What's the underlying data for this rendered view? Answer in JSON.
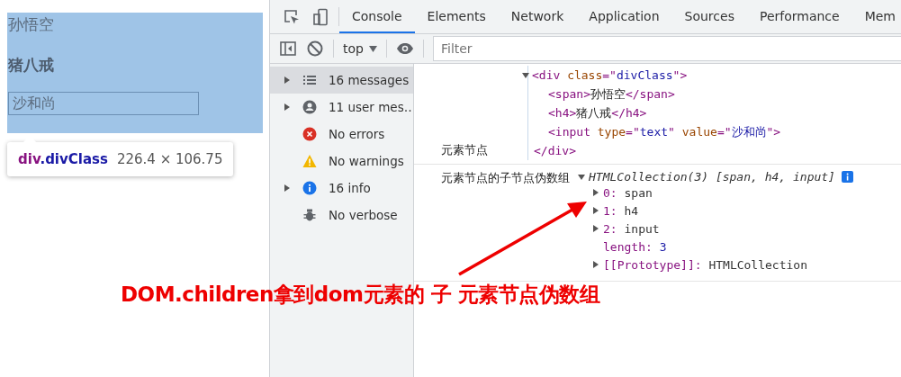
{
  "page": {
    "span_text": "孙悟空",
    "h4_text": "猪八戒",
    "input_value": "沙和尚",
    "tooltip": {
      "tag": "div",
      "cls": ".divClass",
      "size": "226.4 × 106.75"
    }
  },
  "tabs": [
    {
      "label": "Console",
      "selected": true
    },
    {
      "label": "Elements",
      "selected": false
    },
    {
      "label": "Network",
      "selected": false
    },
    {
      "label": "Application",
      "selected": false
    },
    {
      "label": "Sources",
      "selected": false
    },
    {
      "label": "Performance",
      "selected": false
    },
    {
      "label": "Mem",
      "selected": false
    }
  ],
  "context": "top",
  "filter": {
    "placeholder": "Filter"
  },
  "sidebar": [
    {
      "kind": "list",
      "label": "16 messages",
      "expandable": true,
      "selected": true
    },
    {
      "kind": "user",
      "label": "11 user mes…",
      "expandable": true,
      "selected": false
    },
    {
      "kind": "error",
      "label": "No errors",
      "expandable": false,
      "selected": false
    },
    {
      "kind": "warning",
      "label": "No warnings",
      "expandable": false,
      "selected": false
    },
    {
      "kind": "info",
      "label": "16 info",
      "expandable": true,
      "selected": false
    },
    {
      "kind": "verbose",
      "label": "No verbose",
      "expandable": false,
      "selected": false
    }
  ],
  "messages": [
    {
      "kind": "html",
      "label": "元素节点",
      "lines": [
        [
          {
            "kind": "tag",
            "s": "<div "
          },
          {
            "kind": "attr",
            "s": "class"
          },
          {
            "kind": "tag",
            "s": "=\""
          },
          {
            "kind": "val",
            "s": "divClass"
          },
          {
            "kind": "tag",
            "s": "\">"
          }
        ],
        [
          {
            "kind": "tag",
            "s": "<span>"
          },
          {
            "kind": "text",
            "s": "孙悟空"
          },
          {
            "kind": "tag",
            "s": "</span>"
          }
        ],
        [
          {
            "kind": "tag",
            "s": "<h4>"
          },
          {
            "kind": "text",
            "s": "猪八戒"
          },
          {
            "kind": "tag",
            "s": "</h4>"
          }
        ],
        [
          {
            "kind": "tag",
            "s": "<input "
          },
          {
            "kind": "attr",
            "s": "type"
          },
          {
            "kind": "tag",
            "s": "=\""
          },
          {
            "kind": "val",
            "s": "text"
          },
          {
            "kind": "tag",
            "s": "\" "
          },
          {
            "kind": "attr",
            "s": "value"
          },
          {
            "kind": "tag",
            "s": "=\""
          },
          {
            "kind": "val",
            "s": "沙和尚"
          },
          {
            "kind": "tag",
            "s": "\">"
          }
        ],
        [
          {
            "kind": "tag",
            "s": "</div>"
          }
        ]
      ]
    },
    {
      "kind": "object",
      "label": "元素节点的子节点伪数组",
      "summary": "HTMLCollection(3) [span, h4, input]",
      "rows": [
        {
          "key": "0:",
          "value": "span",
          "expandable": true
        },
        {
          "key": "1:",
          "value": "h4",
          "expandable": true
        },
        {
          "key": "2:",
          "value": "input",
          "expandable": true
        },
        {
          "key": "length:",
          "value": "3",
          "expandable": false
        },
        {
          "key": "[[Prototype]]:",
          "value": "HTMLCollection",
          "expandable": true
        }
      ]
    }
  ],
  "annotation": "DOM.children拿到dom元素的 子 元素节点伪数组"
}
